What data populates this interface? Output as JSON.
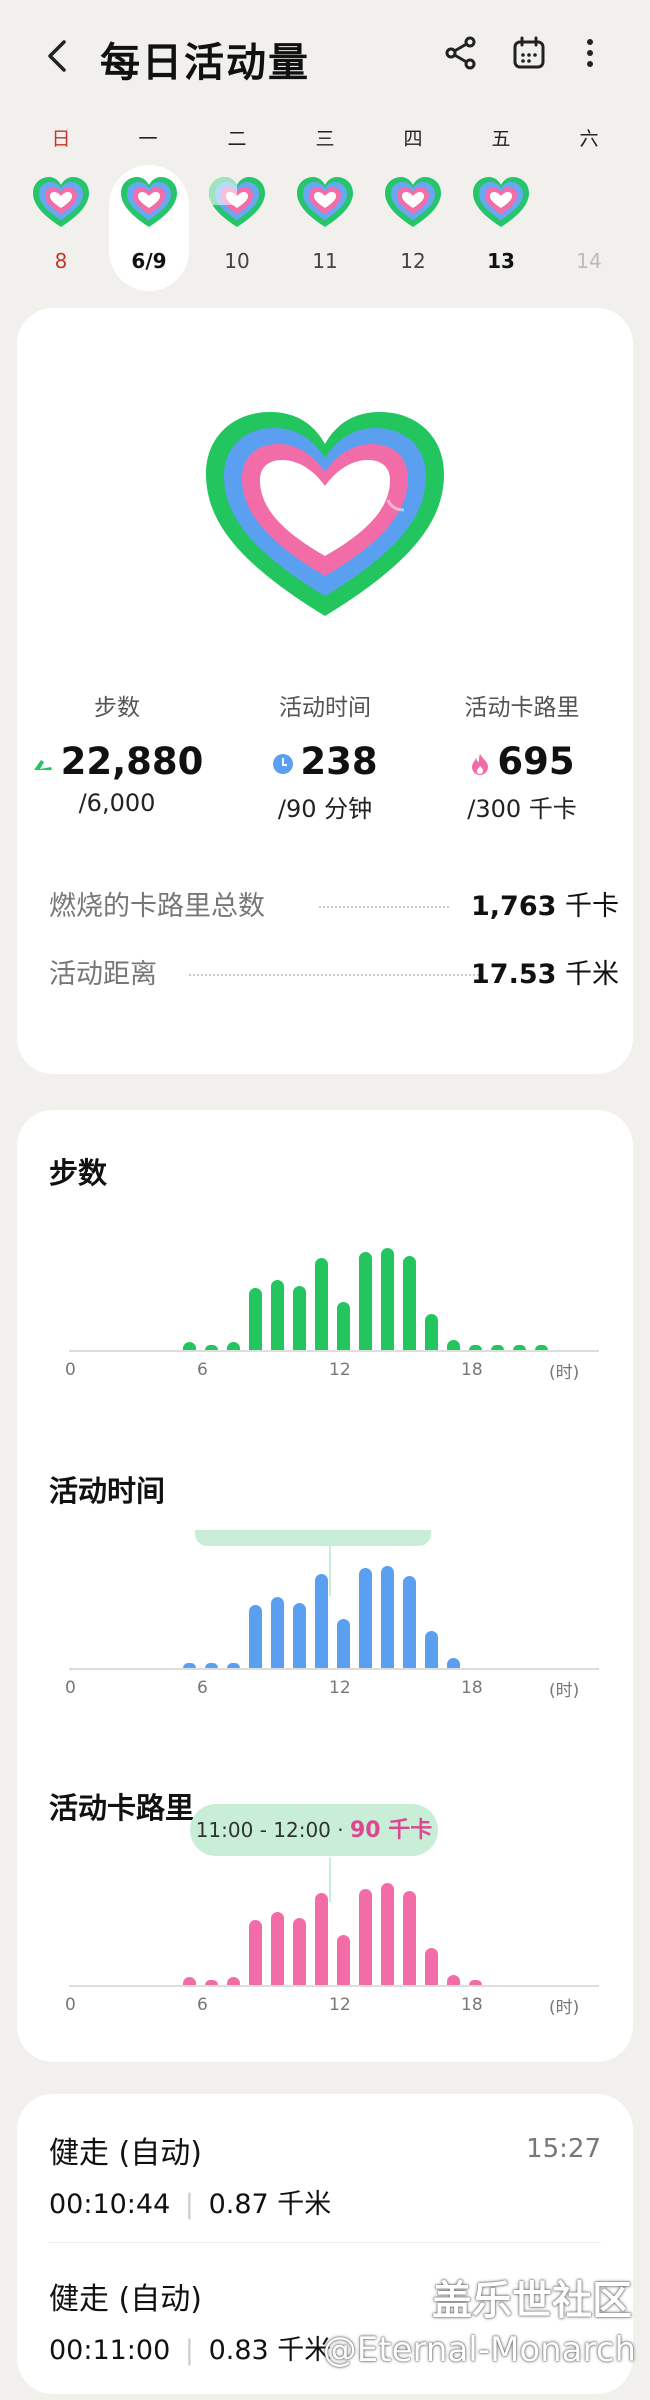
{
  "header": {
    "title": "每日活动量"
  },
  "icons": {
    "back": "back-arrow-icon",
    "share": "share-icon",
    "calendar": "calendar-icon",
    "more": "more-vert-icon"
  },
  "week": {
    "weekdays": [
      "日",
      "一",
      "二",
      "三",
      "四",
      "五",
      "六"
    ],
    "days": [
      {
        "label": "8",
        "state": "normal"
      },
      {
        "label": "6/9",
        "state": "selected"
      },
      {
        "label": "10",
        "state": "normal"
      },
      {
        "label": "11",
        "state": "normal"
      },
      {
        "label": "12",
        "state": "normal"
      },
      {
        "label": "13",
        "state": "today"
      },
      {
        "label": "14",
        "state": "future"
      }
    ]
  },
  "summary": {
    "steps": {
      "label": "步数",
      "value": "22,880",
      "goal": "/6,000"
    },
    "active_time": {
      "label": "活动时间",
      "value": "238",
      "goal": "/90 分钟"
    },
    "calories": {
      "label": "活动卡路里",
      "value": "695",
      "goal": "/300 千卡"
    },
    "total_burned": {
      "label": "燃烧的卡路里总数",
      "value": "1,763",
      "unit": "千卡"
    },
    "distance": {
      "label": "活动距离",
      "value": "17.53",
      "unit": "千米"
    }
  },
  "charts": {
    "steps_title": "步数",
    "time_title": "活动时间",
    "cal_title": "活动卡路里",
    "x_ticks": [
      "0",
      "6",
      "12",
      "18",
      "(时)"
    ],
    "tooltip": {
      "time": "11:00 - 12:00",
      "sep": "·",
      "value": "90 千卡"
    }
  },
  "chart_data": [
    {
      "type": "bar",
      "title": "步数",
      "xlabel": "(时)",
      "color": "#22c55e",
      "x": [
        5,
        6,
        7,
        8,
        9,
        10,
        11,
        12,
        13,
        14,
        15,
        16,
        17,
        18,
        19,
        20,
        21
      ],
      "values": [
        8,
        5,
        8,
        62,
        70,
        64,
        92,
        48,
        98,
        102,
        94,
        36,
        10,
        5,
        5,
        5,
        5
      ]
    },
    {
      "type": "bar",
      "title": "活动时间",
      "xlabel": "(时)",
      "color": "#5b9ff0",
      "x": [
        5,
        6,
        7,
        8,
        9,
        10,
        11,
        12,
        13,
        14,
        15,
        16,
        17
      ],
      "values": [
        5,
        5,
        5,
        62,
        70,
        64,
        92,
        48,
        98,
        100,
        90,
        36,
        10
      ]
    },
    {
      "type": "bar",
      "title": "活动卡路里",
      "xlabel": "(时)",
      "color": "#f26da8",
      "x": [
        5,
        6,
        7,
        8,
        9,
        10,
        11,
        12,
        13,
        14,
        15,
        16,
        17,
        18
      ],
      "values": [
        8,
        5,
        8,
        62,
        70,
        64,
        88,
        48,
        92,
        98,
        90,
        36,
        10,
        5
      ]
    }
  ],
  "exercises": [
    {
      "title": "健走 (自动)",
      "time": "15:27",
      "duration": "00:10:44",
      "distance": "0.87 千米"
    },
    {
      "title": "健走 (自动)",
      "duration": "00:11:00",
      "distance": "0.83 千米"
    }
  ],
  "watermark": {
    "line1": "盖乐世社区",
    "line2": "@Eternal-Monarch"
  }
}
